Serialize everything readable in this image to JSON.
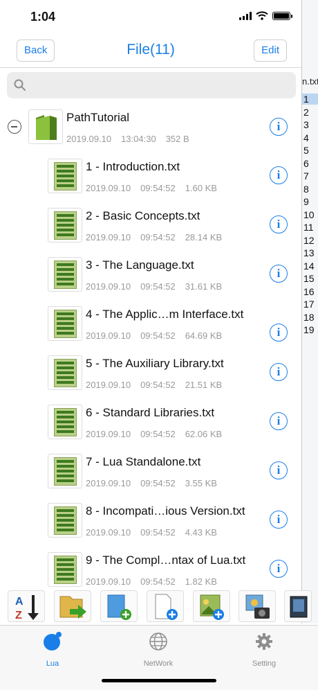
{
  "status": {
    "time": "1:04"
  },
  "nav": {
    "back": "Back",
    "title": "File(11)",
    "edit": "Edit"
  },
  "search": {
    "placeholder": ""
  },
  "folder": {
    "name": "PathTutorial",
    "date": "2019.09.10",
    "time": "13:04:30",
    "size": "352 B"
  },
  "files": [
    {
      "name": "1 - Introduction.txt",
      "date": "2019.09.10",
      "time": "09:54:52",
      "size": "1.60 KB"
    },
    {
      "name": "2 - Basic Concepts.txt",
      "date": "2019.09.10",
      "time": "09:54:52",
      "size": "28.14 KB"
    },
    {
      "name": "3 - The Language.txt",
      "date": "2019.09.10",
      "time": "09:54:52",
      "size": "31.61 KB"
    },
    {
      "name": "4 - The Applic…m Interface.txt",
      "date": "2019.09.10",
      "time": "09:54:52",
      "size": "64.69 KB"
    },
    {
      "name": "5 - The Auxiliary Library.txt",
      "date": "2019.09.10",
      "time": "09:54:52",
      "size": "21.51 KB"
    },
    {
      "name": "6 - Standard Libraries.txt",
      "date": "2019.09.10",
      "time": "09:54:52",
      "size": "62.06 KB"
    },
    {
      "name": "7 - Lua Standalone.txt",
      "date": "2019.09.10",
      "time": "09:54:52",
      "size": "3.55 KB"
    },
    {
      "name": "8 - Incompati…ious Version.txt",
      "date": "2019.09.10",
      "time": "09:54:52",
      "size": "4.43 KB"
    },
    {
      "name": "9 - The Compl…ntax of Lua.txt",
      "date": "2019.09.10",
      "time": "09:54:52",
      "size": "1.82 KB"
    }
  ],
  "info_glyph": "i",
  "index": {
    "header": "n.txt",
    "numbers": [
      "1",
      "2",
      "3",
      "4",
      "5",
      "6",
      "7",
      "8",
      "9",
      "10",
      "11",
      "12",
      "13",
      "14",
      "15",
      "16",
      "17",
      "18",
      "19"
    ],
    "selected": "1"
  },
  "tabs": [
    {
      "label": "Lua",
      "icon": "lua-icon",
      "active": true
    },
    {
      "label": "NetWork",
      "icon": "globe-icon",
      "active": false
    },
    {
      "label": "Setting",
      "icon": "gear-icon",
      "active": false
    }
  ],
  "colors": {
    "accent": "#1a7ee8",
    "meta": "#9a9a9a"
  }
}
